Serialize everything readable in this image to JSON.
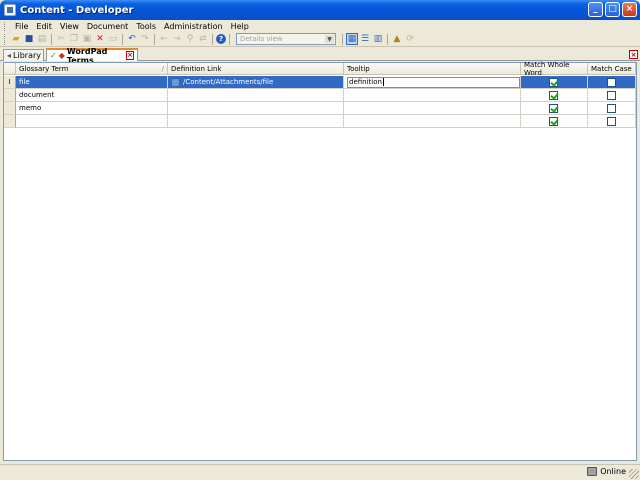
{
  "window": {
    "title": "Content - Developer"
  },
  "menu": [
    "File",
    "Edit",
    "View",
    "Document",
    "Tools",
    "Administration",
    "Help"
  ],
  "toolbar": {
    "view_select": "Details view"
  },
  "tabs": [
    {
      "label": "Library"
    },
    {
      "label": "WordPad Terms",
      "close": "×"
    }
  ],
  "strip_close": "×",
  "grid": {
    "columns": [
      "Glossary Term",
      "Definition Link",
      "Tooltip",
      "Match Whole Word",
      "Match Case"
    ],
    "sort_glyph": "/",
    "rows": [
      {
        "indicator": "I",
        "term": "file",
        "link": "/Content/Attachments/file",
        "tooltip": "definition",
        "match_whole_word": true,
        "match_case": false
      },
      {
        "indicator": "",
        "term": "document",
        "link": "",
        "tooltip": "",
        "match_whole_word": true,
        "match_case": false
      },
      {
        "indicator": "",
        "term": "memo",
        "link": "",
        "tooltip": "",
        "match_whole_word": true,
        "match_case": false
      },
      {
        "indicator": "",
        "term": "",
        "link": "",
        "tooltip": "",
        "match_whole_word": true,
        "match_case": false
      }
    ]
  },
  "status": {
    "connection": "Online"
  },
  "colors": {
    "selection": "#316ac5",
    "titlebar": "#0754d6",
    "checkmark": "#21a121"
  }
}
